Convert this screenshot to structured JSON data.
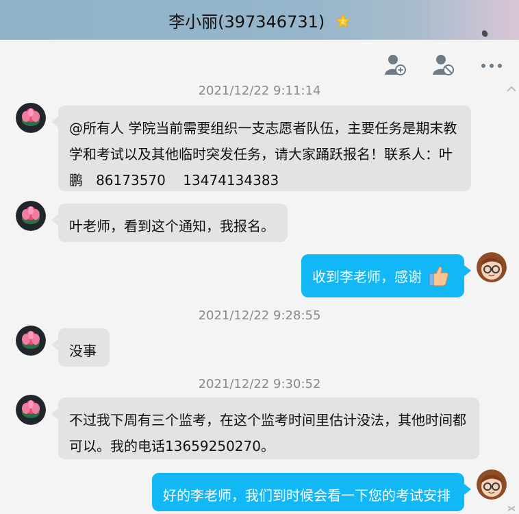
{
  "window": {
    "title": "李小丽(397346731)",
    "vip_badge": "vip-star-icon"
  },
  "toolbar": {
    "add_contact": "add-friend-icon",
    "block_contact": "block-user-icon",
    "more": "more-options-icon"
  },
  "messages": [
    {
      "type": "timestamp",
      "text": "2021/12/22 9:11:14"
    },
    {
      "type": "message",
      "side": "left",
      "text": "@所有人 学院当前需要组织一支志愿者队伍，主要任务是期末教学和考试以及其他临时突发任务，请大家踊跃报名！联系人：叶鹏   86173570    13474134383"
    },
    {
      "type": "message",
      "side": "left",
      "text": "叶老师，看到这个通知，我报名。"
    },
    {
      "type": "message",
      "side": "right",
      "text": "收到李老师，感谢"
    },
    {
      "type": "timestamp",
      "text": "2021/12/22 9:28:55"
    },
    {
      "type": "message",
      "side": "left",
      "text": "没事"
    },
    {
      "type": "timestamp",
      "text": "2021/12/22 9:30:52"
    },
    {
      "type": "message",
      "side": "left",
      "text": "不过我下周有三个监考，在这个监考时间里估计没法，其他时间都可以。我的电话13659250270。"
    },
    {
      "type": "message",
      "side": "right",
      "text": "好的李老师，我们到时候会看一下您的考试安排"
    }
  ],
  "colors": {
    "title_bg_start": "#8fb2c8",
    "title_bg_end": "#d9c6d6",
    "incoming_bubble": "#e3e3e3",
    "outgoing_bubble": "#12b7f5",
    "timestamp_text": "#8a8a8a"
  }
}
